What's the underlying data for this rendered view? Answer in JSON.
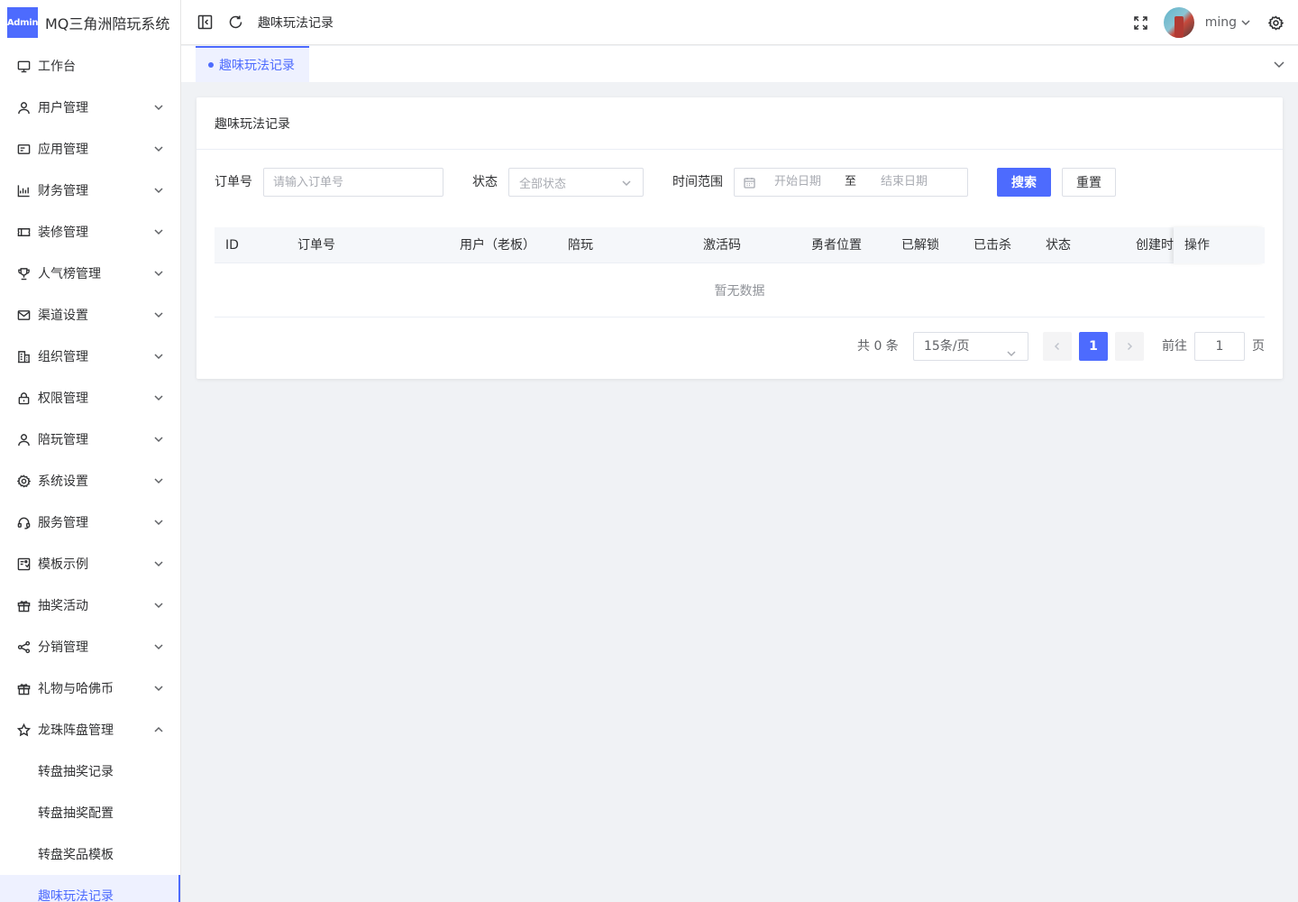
{
  "app": {
    "badge": "Admin",
    "title": "MQ三角洲陪玩系统"
  },
  "sidebar": {
    "items": [
      {
        "label": "工作台",
        "icon": "monitor-icon",
        "expandable": false
      },
      {
        "label": "用户管理",
        "icon": "user-icon",
        "expandable": true
      },
      {
        "label": "应用管理",
        "icon": "app-icon",
        "expandable": true
      },
      {
        "label": "财务管理",
        "icon": "chart-icon",
        "expandable": true
      },
      {
        "label": "装修管理",
        "icon": "ticket-icon",
        "expandable": true
      },
      {
        "label": "人气榜管理",
        "icon": "trophy-icon",
        "expandable": true
      },
      {
        "label": "渠道设置",
        "icon": "mail-icon",
        "expandable": true
      },
      {
        "label": "组织管理",
        "icon": "office-building-icon",
        "expandable": true
      },
      {
        "label": "权限管理",
        "icon": "lock-icon",
        "expandable": true
      },
      {
        "label": "陪玩管理",
        "icon": "user-icon",
        "expandable": true
      },
      {
        "label": "系统设置",
        "icon": "gear-icon",
        "expandable": true
      },
      {
        "label": "服务管理",
        "icon": "headset-icon",
        "expandable": true
      },
      {
        "label": "模板示例",
        "icon": "template-icon",
        "expandable": true
      },
      {
        "label": "抽奖活动",
        "icon": "gift-icon",
        "expandable": true
      },
      {
        "label": "分销管理",
        "icon": "share-icon",
        "expandable": true
      },
      {
        "label": "礼物与哈佛币",
        "icon": "gift-icon",
        "expandable": true
      },
      {
        "label": "龙珠阵盘管理",
        "icon": "star-icon",
        "expandable": true,
        "expanded": true
      }
    ],
    "submenu": [
      {
        "label": "转盘抽奖记录",
        "active": false
      },
      {
        "label": "转盘抽奖配置",
        "active": false
      },
      {
        "label": "转盘奖品模板",
        "active": false
      },
      {
        "label": "趣味玩法记录",
        "active": true
      }
    ]
  },
  "header": {
    "breadcrumb": "趣味玩法记录",
    "username": "ming"
  },
  "tags": [
    {
      "label": "趣味玩法记录",
      "active": true
    }
  ],
  "card": {
    "title": "趣味玩法记录"
  },
  "filters": {
    "order_label": "订单号",
    "order_placeholder": "请输入订单号",
    "order_value": "",
    "status_label": "状态",
    "status_value": "全部状态",
    "time_label": "时间范围",
    "start_placeholder": "开始日期",
    "range_separator": "至",
    "end_placeholder": "结束日期",
    "search_label": "搜索",
    "reset_label": "重置"
  },
  "table": {
    "columns": [
      "ID",
      "订单号",
      "用户（老板）",
      "陪玩",
      "激活码",
      "勇者位置",
      "已解锁",
      "已击杀",
      "状态",
      "创建时间",
      "操作"
    ],
    "empty_text": "暂无数据",
    "rows": []
  },
  "pagination": {
    "total_text": "共 0 条",
    "page_size": "15条/页",
    "current_page": "1",
    "goto_label": "前往",
    "goto_value": "1",
    "page_suffix": "页"
  },
  "colors": {
    "accent": "#4d6bfe",
    "active_bg": "#eef1ff",
    "background": "#f0f2f5"
  }
}
